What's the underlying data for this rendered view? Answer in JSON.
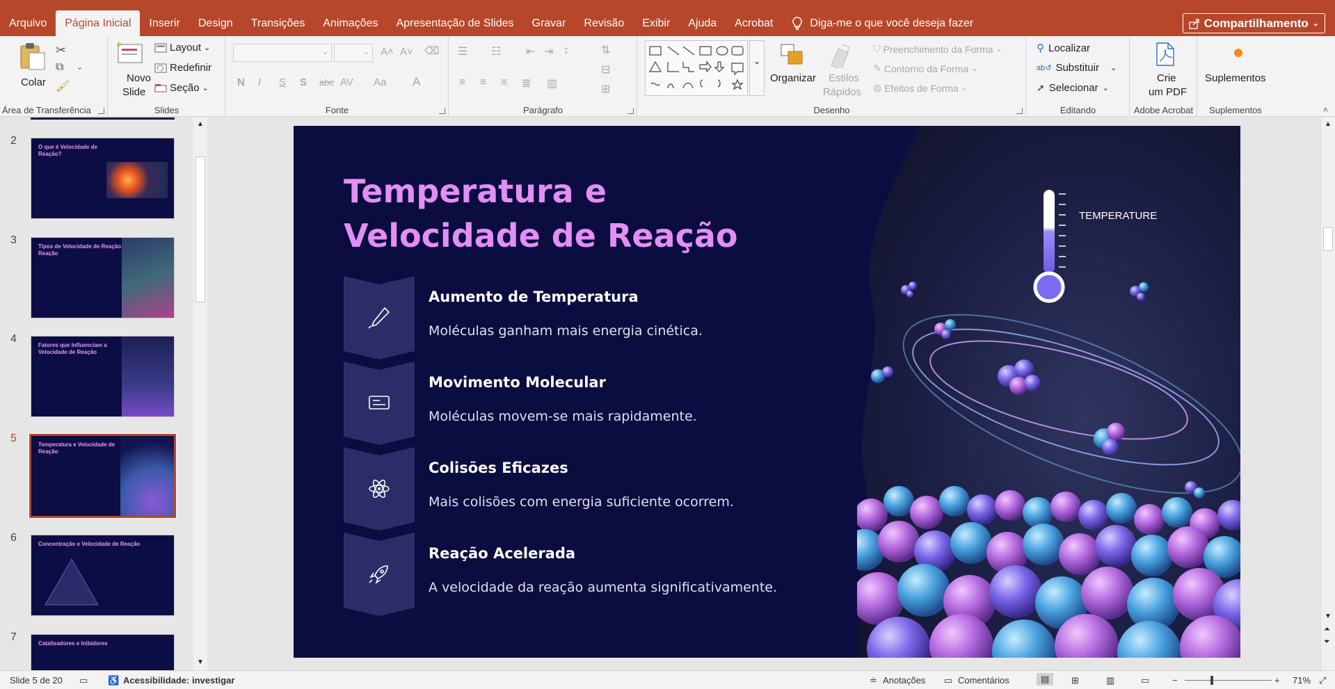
{
  "tabs": [
    "Arquivo",
    "Página Inicial",
    "Inserir",
    "Design",
    "Transições",
    "Animações",
    "Apresentação de Slides",
    "Gravar",
    "Revisão",
    "Exibir",
    "Ajuda",
    "Acrobat"
  ],
  "active_tab": "Página Inicial",
  "tell_me": "Diga-me o que você deseja fazer",
  "share_label": "Compartilhamento",
  "ribbon": {
    "clipboard": {
      "paste": "Colar",
      "label": "Área de Transferência"
    },
    "slides": {
      "new_slide_1": "Novo",
      "new_slide_2": "Slide",
      "layout": "Layout",
      "reset": "Redefinir",
      "section": "Seção",
      "label": "Slides"
    },
    "font": {
      "label": "Fonte",
      "bold": "N",
      "italic": "I",
      "underline": "S",
      "shadow": "S",
      "strike": "abc",
      "spacing": "AV",
      "case": "Aa",
      "color": "A"
    },
    "paragraph": {
      "label": "Parágrafo"
    },
    "drawing": {
      "arrange": "Organizar",
      "quick_styles_1": "Estilos",
      "quick_styles_2": "Rápidos",
      "shape_fill": "Preenchimento da Forma",
      "shape_outline": "Contorno da Forma",
      "shape_effects": "Efeitos de Forma",
      "label": "Desenho"
    },
    "editing": {
      "find": "Localizar",
      "replace": "Substituir",
      "select": "Selecionar",
      "label": "Editando"
    },
    "acrobat": {
      "create_1": "Crie",
      "create_2": "um PDF",
      "label": "Adobe Acrobat"
    },
    "addins": {
      "button": "Suplementos",
      "label": "Suplementos"
    }
  },
  "thumbnails": [
    {
      "num": "2",
      "title": "O que é Velocidade de Reação?"
    },
    {
      "num": "3",
      "title": "Tipos de Velocidade de Reação Reação"
    },
    {
      "num": "4",
      "title": "Fatores que Influenciam a Velocidade de Reação"
    },
    {
      "num": "5",
      "title": "Temperatura e Velocidade de Reação"
    },
    {
      "num": "6",
      "title": "Concentração e Velocidade de Reação"
    },
    {
      "num": "7",
      "title": "Catalisadores e Inibidores"
    }
  ],
  "slide": {
    "title": "Temperatura e Velocidade de Reação",
    "temperature_label": "TEMPERATURE",
    "items": [
      {
        "icon": "thermometer-icon",
        "heading": "Aumento de Temperatura",
        "desc": "Moléculas ganham mais energia cinética."
      },
      {
        "icon": "molecule-card-icon",
        "heading": "Movimento Molecular",
        "desc": "Moléculas movem-se mais rapidamente."
      },
      {
        "icon": "atom-icon",
        "heading": "Colisões Eficazes",
        "desc": "Mais colisões com energia suficiente ocorrem."
      },
      {
        "icon": "rocket-icon",
        "heading": "Reação Acelerada",
        "desc": "A velocidade da reação aumenta significativamente."
      }
    ]
  },
  "status": {
    "slide_counter": "Slide 5 de 20",
    "accessibility": "Acessibilidade: investigar",
    "notes": "Anotações",
    "comments": "Comentários",
    "zoom": "71%"
  },
  "colors": {
    "accent": "#b7472a",
    "slide_bg": "#0b0c3f",
    "title": "#e38ef5"
  }
}
